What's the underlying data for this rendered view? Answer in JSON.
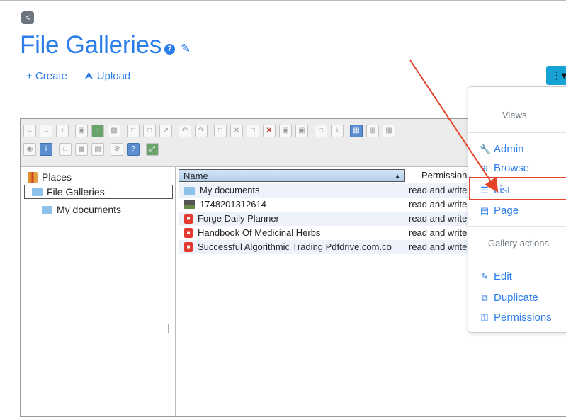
{
  "header": {
    "back_label": "<",
    "title": "File Galleries"
  },
  "actions": {
    "create_label": "+ Create",
    "upload_label": "Upload"
  },
  "tree": {
    "items": [
      {
        "label": "Places"
      },
      {
        "label": "File Galleries"
      },
      {
        "label": "My documents"
      }
    ]
  },
  "table": {
    "columns": [
      "Name",
      "Permissions"
    ],
    "rows": [
      {
        "name": "My documents",
        "perm": "read and write",
        "type": "folder"
      },
      {
        "name": "1748201312614",
        "perm": "read and write",
        "type": "image"
      },
      {
        "name": "Forge Daily Planner",
        "perm": "read and write",
        "type": "pdf"
      },
      {
        "name": "Handbook Of Medicinal Herbs",
        "perm": "read and write",
        "type": "pdf"
      },
      {
        "name": "Successful Algorithmic Trading Pdfdrive.com.co",
        "perm": "read and write",
        "type": "pdf"
      }
    ]
  },
  "menu": {
    "views_header": "Views",
    "views": [
      {
        "label": "Admin",
        "icon": "wrench-icon"
      },
      {
        "label": "Browse",
        "icon": "zoom-icon"
      },
      {
        "label": "List",
        "icon": "list-icon"
      },
      {
        "label": "Page",
        "icon": "page-icon"
      }
    ],
    "actions_header": "Gallery actions",
    "actions": [
      {
        "label": "Edit",
        "icon": "edit-icon"
      },
      {
        "label": "Duplicate",
        "icon": "duplicate-icon"
      },
      {
        "label": "Permissions",
        "icon": "key-icon"
      }
    ]
  },
  "colors": {
    "accent": "#2b7de9",
    "annotation": "#e6442a",
    "menu_button": "#17a2d6"
  }
}
